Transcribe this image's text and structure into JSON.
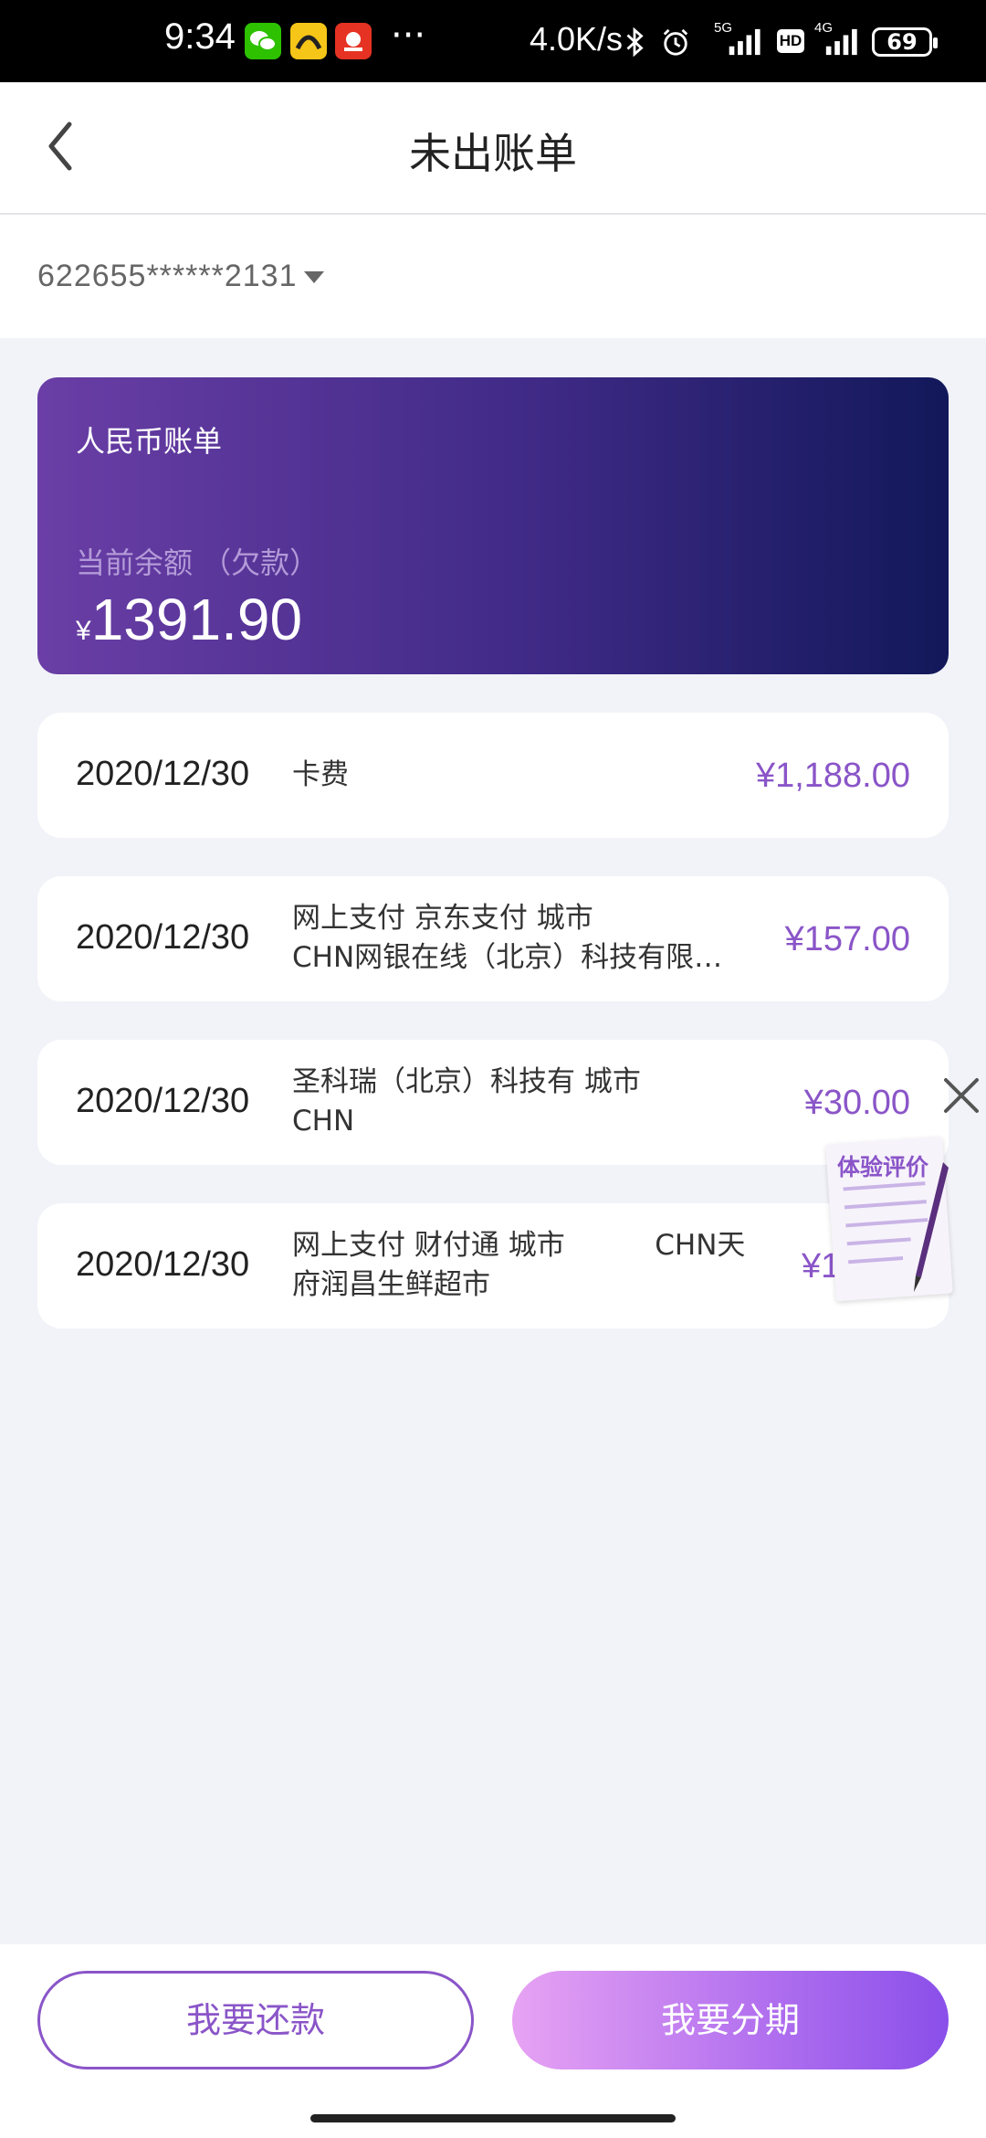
{
  "status": {
    "time": "9:34",
    "dots": "···",
    "speed": "4.0K/s",
    "battery": "69",
    "net1": "5G",
    "net2": "4G",
    "hd": "HD"
  },
  "header": {
    "title": "未出账单"
  },
  "account": {
    "number": "622655******2131"
  },
  "summary": {
    "title": "人民币账单",
    "label": "当前余额 （欠款）",
    "currency": "¥",
    "amount": "1391.90"
  },
  "transactions": [
    {
      "date": "2020/12/30",
      "line1": "卡费",
      "line2": "",
      "amount": "¥1,188.00"
    },
    {
      "date": "2020/12/30",
      "line1": "网上支付 京东支付 城市",
      "line2": "CHN网银在线（北京）科技有限…",
      "amount": "¥157.00"
    },
    {
      "date": "2020/12/30",
      "line1": "圣科瑞（北京）科技有 城市",
      "line2": "CHN",
      "amount": "¥30.00"
    },
    {
      "date": "2020/12/30",
      "line1": "网上支付 财付通 城市          CHN天",
      "line2": "府润昌生鲜超市",
      "amount": "¥1"
    }
  ],
  "float": {
    "eval_label": "体验评价"
  },
  "actions": {
    "repay": "我要还款",
    "installment": "我要分期"
  },
  "colors": {
    "accent": "#8a55c8",
    "card_start": "#6a3ea6",
    "card_end": "#12185a"
  }
}
